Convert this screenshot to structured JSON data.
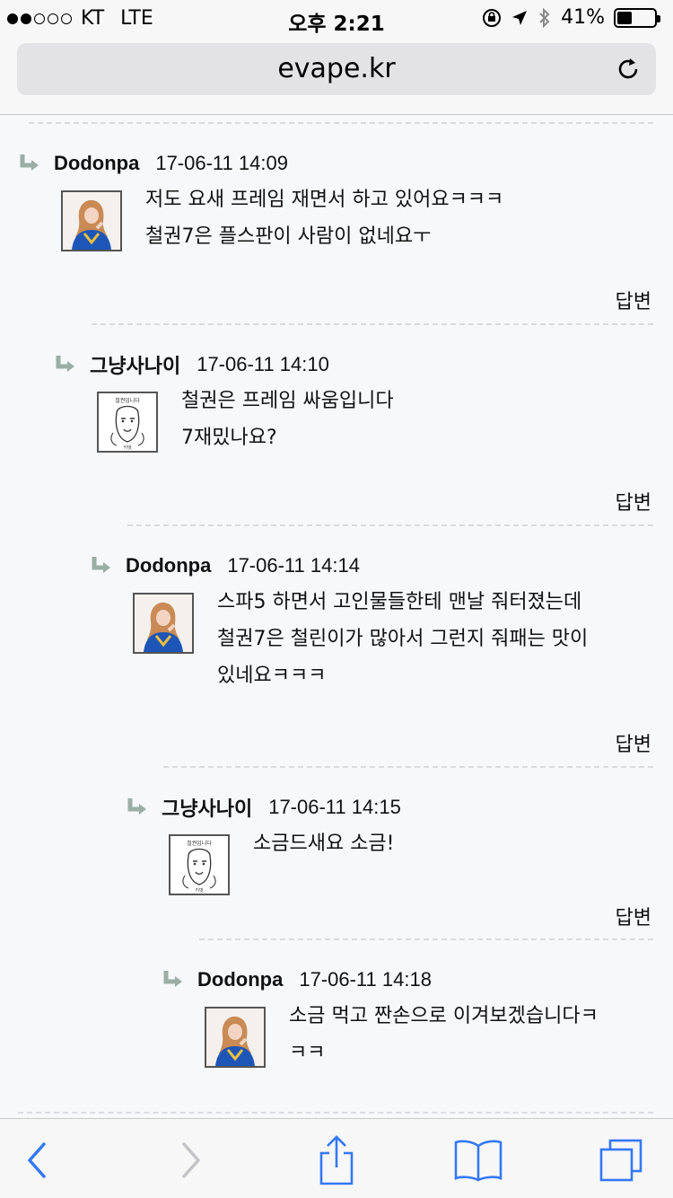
{
  "status_bar": {
    "carrier": "KT",
    "network": "LTE",
    "time": "오후 2:21",
    "battery": "41%",
    "battery_level": 0.41
  },
  "url_bar": {
    "domain": "evape.kr"
  },
  "comments": [
    {
      "author": "Dodonpa",
      "date": "17-06-11 14:09",
      "avatar": "avatar-girl-blue",
      "lines": [
        "저도 요새 프레임 재면서 하고  있어요ㅋㅋㅋ",
        "철권7은 플스판이 사람이 없네요ㅜ"
      ],
      "reply_label": "답변"
    },
    {
      "author": "그냥사나이",
      "date": "17-06-11 14:10",
      "avatar": "avatar-sketch-face",
      "lines": [
        "철권은 프레임 싸움입니다",
        "7재밌나요?"
      ],
      "reply_label": "답변"
    },
    {
      "author": "Dodonpa",
      "date": "17-06-11 14:14",
      "avatar": "avatar-girl-blue",
      "lines": [
        "스파5 하면서 고인물들한테 맨날 줘터졌는데",
        "철권7은 철린이가 많아서 그런지 줘패는 맛이",
        "있네요ㅋㅋㅋ"
      ],
      "reply_label": "답변"
    },
    {
      "author": "그냥사나이",
      "date": "17-06-11 14:15",
      "avatar": "avatar-sketch-face",
      "lines": [
        "소금드새요 소금!"
      ],
      "reply_label": "답변"
    },
    {
      "author": "Dodonpa",
      "date": "17-06-11 14:18",
      "avatar": "avatar-girl-blue",
      "lines": [
        "소금 먹고 짠손으로 이겨보겠습니다ㅋ",
        "ㅋㅋ"
      ],
      "reply_label": ""
    }
  ],
  "toolbar": {
    "back": "back-icon",
    "forward": "forward-icon",
    "share": "share-icon",
    "bookmarks": "bookmarks-icon",
    "tabs": "tabs-icon"
  },
  "colors": {
    "accent": "#3478f6",
    "arrow": "#9aaea5",
    "disabled": "#c4c4c8"
  }
}
